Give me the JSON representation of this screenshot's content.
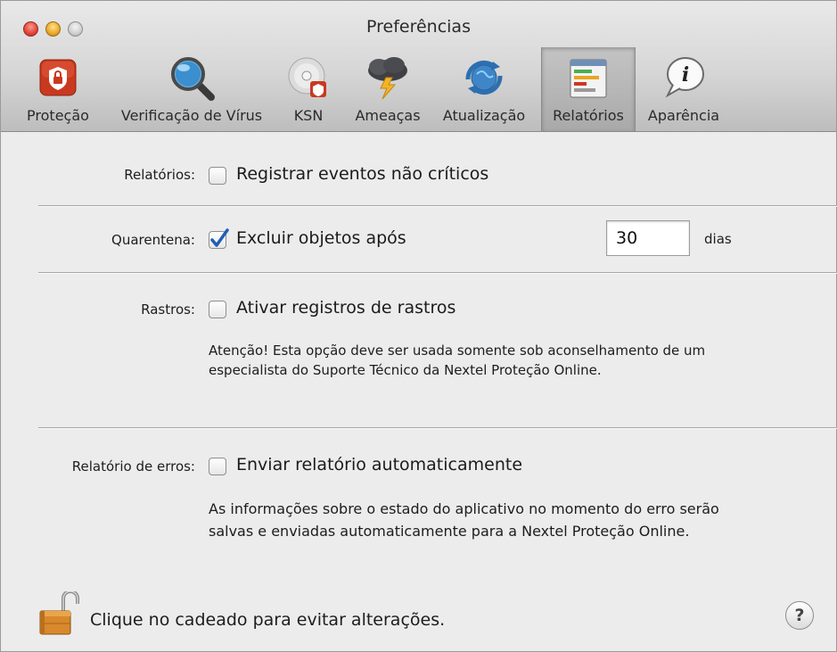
{
  "window": {
    "title": "Preferências"
  },
  "toolbar": {
    "items": [
      {
        "label": "Proteção",
        "icon": "shield-icon"
      },
      {
        "label": "Verificação de Vírus",
        "icon": "magnifier-icon"
      },
      {
        "label": "KSN",
        "icon": "disc-icon"
      },
      {
        "label": "Ameaças",
        "icon": "storm-cloud-icon"
      },
      {
        "label": "Atualização",
        "icon": "globe-update-icon"
      },
      {
        "label": "Relatórios",
        "icon": "report-icon",
        "selected": true
      },
      {
        "label": "Aparência",
        "icon": "info-bubble-icon"
      }
    ]
  },
  "reports": {
    "label": "Relatórios:",
    "checkbox_label": "Registrar eventos não críticos",
    "checked": false
  },
  "quarantine": {
    "label": "Quarentena:",
    "checkbox_label": "Excluir objetos após",
    "checked": true,
    "days_value": "30",
    "unit": "dias"
  },
  "traces": {
    "label": "Rastros:",
    "checkbox_label": "Ativar registros de rastros",
    "checked": false,
    "note_line1": "Atenção! Esta opção deve ser usada somente sob aconselhamento de um",
    "note_line2": "especialista do Suporte Técnico da Nextel Proteção Online."
  },
  "error_report": {
    "label": "Relatório de erros:",
    "checkbox_label": "Enviar relatório automaticamente",
    "checked": false,
    "note_line1": "As informações sobre o estado do aplicativo no momento do erro serão",
    "note_line2": "salvas e enviadas automaticamente para a Nextel Proteção Online."
  },
  "footer": {
    "lock_text": "Clique no cadeado para evitar alterações.",
    "help_label": "?"
  }
}
